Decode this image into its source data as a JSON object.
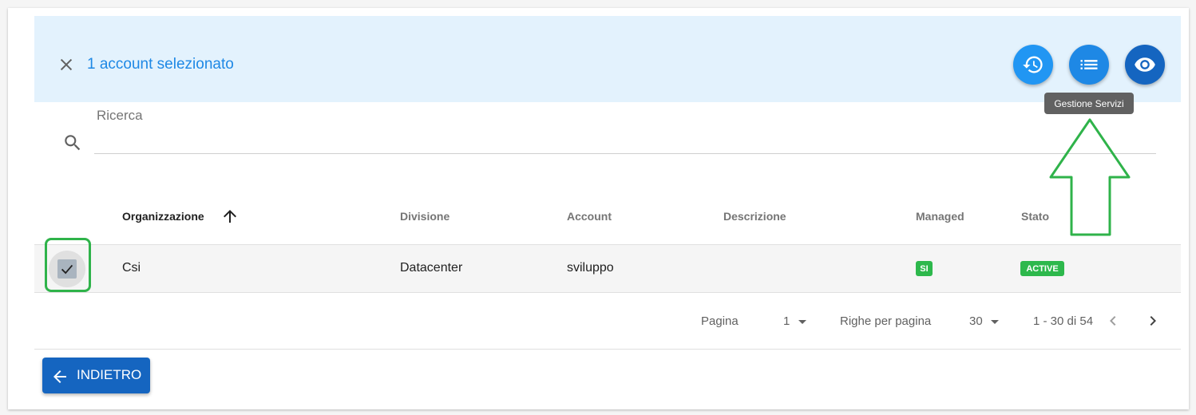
{
  "selection": {
    "text": "1 account selezionato",
    "close_icon": "close-icon",
    "actions": [
      {
        "icon": "history-icon",
        "name": "history"
      },
      {
        "icon": "list-icon",
        "name": "gestione-servizi"
      },
      {
        "icon": "eye-icon",
        "name": "view"
      }
    ],
    "tooltip": "Gestione Servizi"
  },
  "search": {
    "label": "Ricerca",
    "value": "",
    "icon": "search-icon"
  },
  "table": {
    "headers": {
      "organizzazione": "Organizzazione",
      "divisione": "Divisione",
      "account": "Account",
      "descrizione": "Descrizione",
      "managed": "Managed",
      "stato": "Stato"
    },
    "sort_column": "Organizzazione",
    "rows": [
      {
        "selected": true,
        "organizzazione": "Csi",
        "divisione": "Datacenter",
        "account": "sviluppo",
        "descrizione": "",
        "managed": "SI",
        "stato": "ACTIVE"
      }
    ]
  },
  "pagination": {
    "page_label": "Pagina",
    "page_value": "1",
    "rows_label": "Righe per pagina",
    "rows_value": "30",
    "range": "1 - 30 di 54"
  },
  "back_button": {
    "label": "INDIETRO"
  },
  "colors": {
    "selection_bg": "#e3f2fd",
    "accent_blue": "#1e88e5",
    "dark_blue": "#1565c0",
    "status_green": "#2db84c",
    "annotation_green": "#2fb34a"
  }
}
